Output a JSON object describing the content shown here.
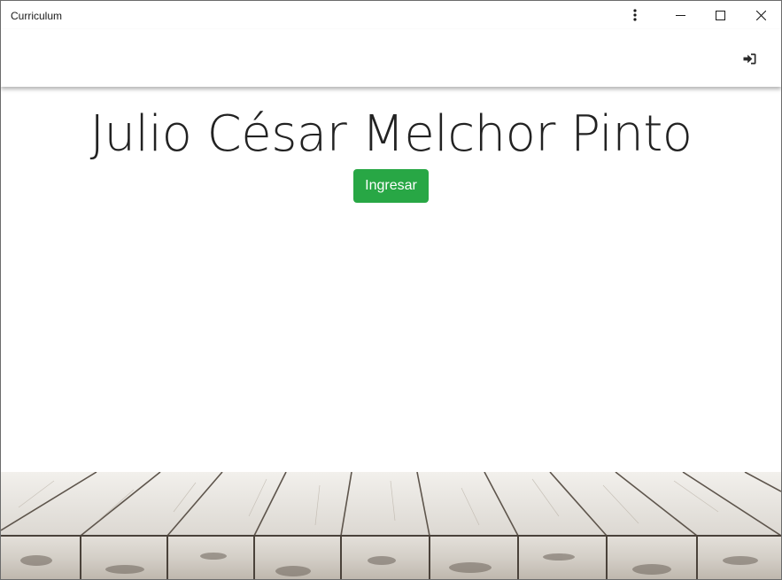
{
  "window": {
    "title": "Curriculum"
  },
  "titlebar_icons": {
    "more": "more-vertical-icon",
    "minimize": "minimize-icon",
    "maximize": "maximize-icon",
    "close": "close-icon"
  },
  "appbar": {
    "login_icon": "sign-in-icon"
  },
  "hero": {
    "name": "Julio César Melchor Pinto",
    "button_label": "Ingresar"
  },
  "colors": {
    "button_green": "#28a745",
    "text_dark": "#222222",
    "background": "#ffffff",
    "wood_light": "#e6e3de",
    "wood_dark": "#6b625a"
  }
}
